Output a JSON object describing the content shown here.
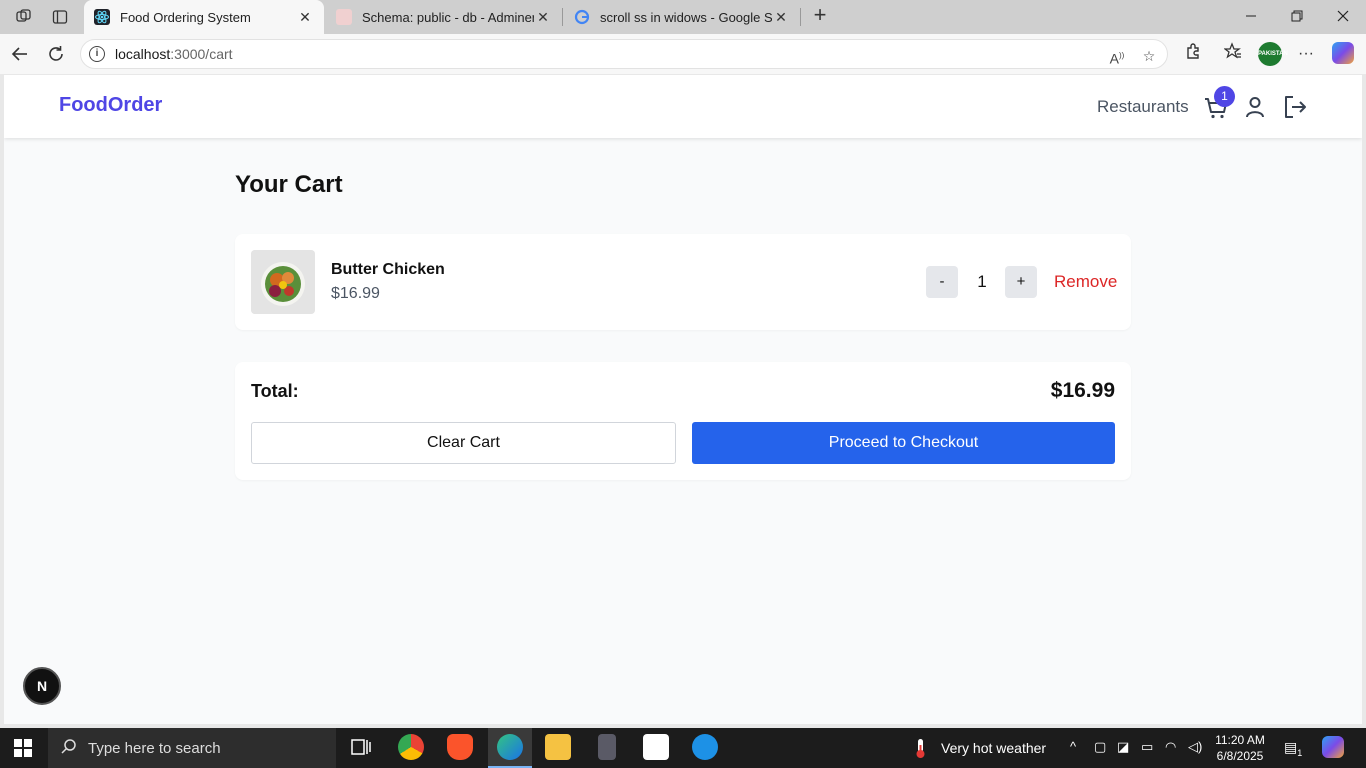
{
  "browser": {
    "tabs": [
      {
        "title": "Food Ordering System",
        "active": true
      },
      {
        "title": "Schema: public - db - Adminer",
        "active": false
      },
      {
        "title": "scroll ss in widows - Google Search",
        "active": false
      }
    ],
    "url_host": "localhost",
    "url_path": ":3000/cart",
    "profile_label": "PAKISTAN"
  },
  "app": {
    "brand": "FoodOrder",
    "nav": {
      "restaurants": "Restaurants"
    },
    "cart_count": "1",
    "page_title": "Your Cart",
    "items": [
      {
        "name": "Butter Chicken",
        "price": "$16.99",
        "quantity": "1",
        "remove_label": "Remove",
        "decrement_label": "-",
        "increment_label": "+"
      }
    ],
    "summary": {
      "total_label": "Total:",
      "total_value": "$16.99",
      "clear_label": "Clear Cart",
      "checkout_label": "Proceed to Checkout"
    },
    "dev_badge": "N"
  },
  "taskbar": {
    "search_placeholder": "Type here to search",
    "weather": "Very hot weather",
    "time": "11:20 AM",
    "date": "6/8/2025",
    "notification_count": "1"
  },
  "colors": {
    "brand": "#4f46e5",
    "primary_button": "#2563eb",
    "remove": "#dc2626",
    "page_bg": "#f9fafb"
  }
}
